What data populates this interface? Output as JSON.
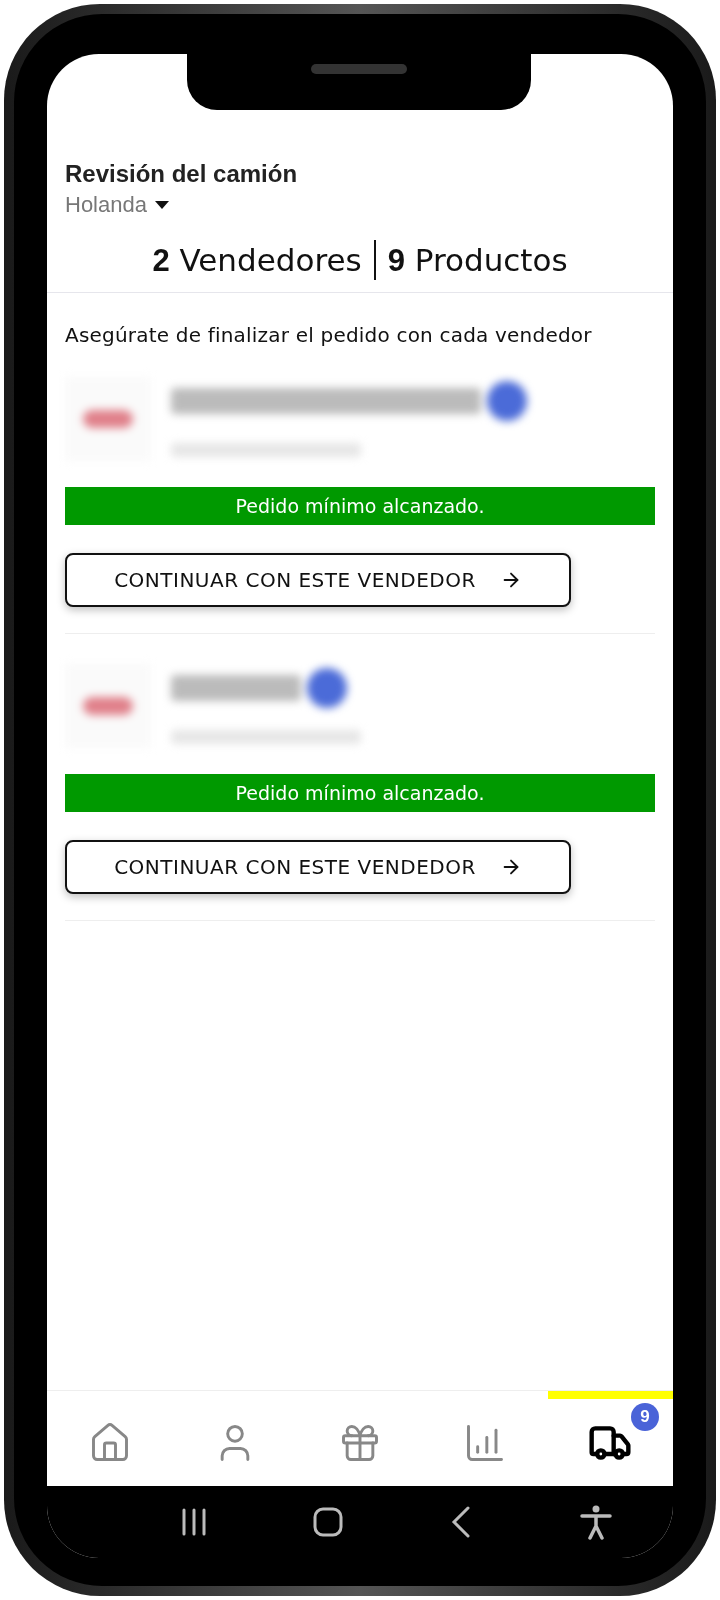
{
  "header": {
    "title": "Revisión del camión",
    "country": "Holanda"
  },
  "summary": [
    {
      "count": "2",
      "label": "Vendedores"
    },
    {
      "count": "9",
      "label": "Productos"
    }
  ],
  "instruction": "Asegúrate de finalizar el pedido con cada vendedor",
  "vendors": [
    {
      "status": "Pedido mínimo alcanzado.",
      "button": "CONTINUAR CON ESTE VENDEDOR"
    },
    {
      "status": "Pedido mínimo alcanzado.",
      "button": "CONTINUAR CON ESTE VENDEDOR"
    }
  ],
  "nav": [
    {
      "kind": "home",
      "selected": false
    },
    {
      "kind": "profile",
      "selected": false
    },
    {
      "kind": "rewards",
      "selected": false
    },
    {
      "kind": "stats",
      "selected": false
    },
    {
      "kind": "truck",
      "selected": true,
      "badge": "9"
    }
  ]
}
